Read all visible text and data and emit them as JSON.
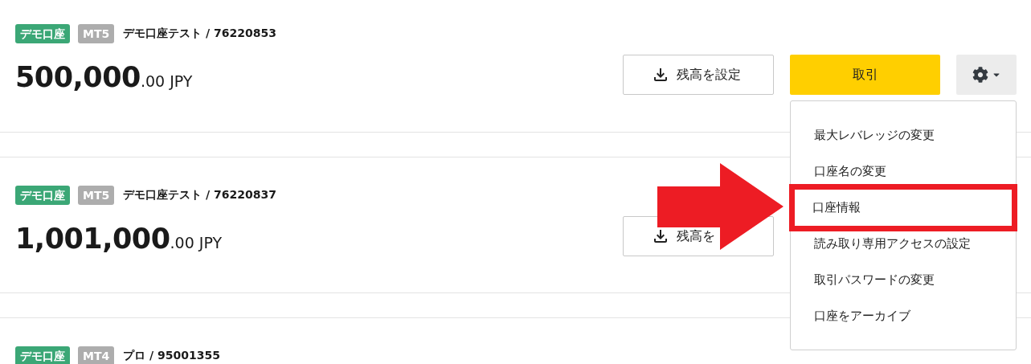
{
  "accounts": [
    {
      "type_badge": "デモ口座",
      "platform_badge": "MT5",
      "name": "デモ口座テスト / 76220853",
      "balance_main": "500,000",
      "balance_decimals": ".00",
      "currency": "JPY",
      "actions": [
        {
          "kind": "balance",
          "label": "残高を設定"
        },
        {
          "kind": "trade",
          "label": "取引"
        },
        {
          "kind": "settings"
        }
      ]
    },
    {
      "type_badge": "デモ口座",
      "platform_badge": "MT5",
      "name": "デモ口座テスト / 76220837",
      "balance_main": "1,001,000",
      "balance_decimals": ".00",
      "currency": "JPY",
      "actions": [
        {
          "kind": "balance",
          "label": "残高を"
        }
      ]
    },
    {
      "type_badge": "デモ口座",
      "platform_badge": "MT4",
      "name": "プロ / 95001355"
    }
  ],
  "settings_menu": {
    "items": [
      {
        "label": "最大レバレッジの変更",
        "highlighted": false
      },
      {
        "label": "口座名の変更",
        "highlighted": false
      },
      {
        "label": "口座情報",
        "highlighted": true
      },
      {
        "label": "読み取り専用アクセスの設定",
        "highlighted": false
      },
      {
        "label": "取引パスワードの変更",
        "highlighted": false
      },
      {
        "label": "口座をアーカイブ",
        "highlighted": false
      }
    ]
  }
}
